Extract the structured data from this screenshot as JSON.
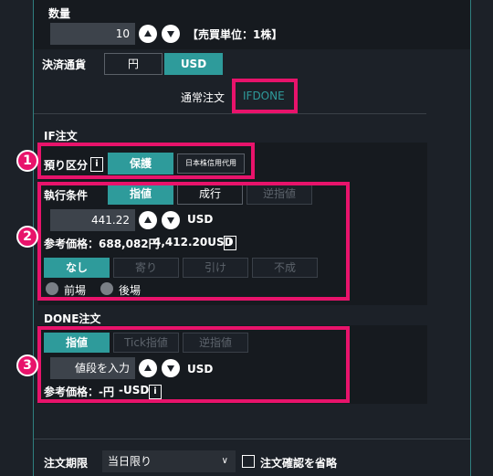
{
  "quantity": {
    "label": "数量",
    "value": "10",
    "unit_note": "【売買単位：1株】"
  },
  "settlement": {
    "label": "決済通貨",
    "options": [
      "円",
      "USD"
    ],
    "selected": "USD"
  },
  "order_type_tabs": {
    "normal": "通常注文",
    "ifdone": "IFDONE",
    "selected": "IFDONE"
  },
  "if_section": {
    "title": "IF注文",
    "deposit": {
      "label": "預り区分",
      "info": "i",
      "option_active": "保護",
      "option_other": "日本株信用代用"
    },
    "exec": {
      "label": "執行条件",
      "options": [
        "指値",
        "成行",
        "逆指値"
      ],
      "price": "441.22",
      "price_unit": "USD",
      "ref_label": "参考価格：688,082円",
      "ref_usd": "4,412.20USD",
      "info": "i",
      "conditions": [
        "なし",
        "寄り",
        "引け",
        "不成"
      ],
      "session": [
        "前場",
        "後場"
      ]
    }
  },
  "done_section": {
    "title": "DONE注文",
    "options": [
      "指値",
      "Tick指値",
      "逆指値"
    ],
    "price_placeholder": "値段を入力",
    "price_unit": "USD",
    "ref_label": "参考価格：-円",
    "ref_usd": "-USD",
    "info": "i"
  },
  "expiry": {
    "label": "注文期限",
    "value": "当日限り",
    "confirm_label": "注文確認を省略"
  },
  "badges": [
    "1",
    "2",
    "3"
  ],
  "colors": {
    "accent": "#2e9b9b",
    "highlight": "#e8136b",
    "background": "#1c2128"
  }
}
